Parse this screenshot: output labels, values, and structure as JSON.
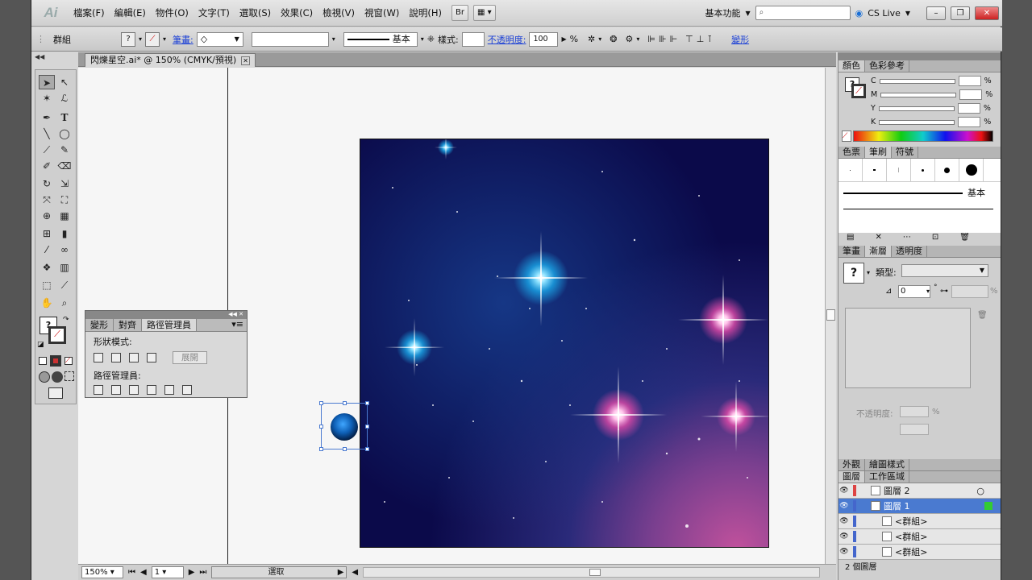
{
  "app": {
    "logo": "Ai",
    "menus": [
      "檔案(F)",
      "編輯(E)",
      "物件(O)",
      "文字(T)",
      "選取(S)",
      "效果(C)",
      "檢視(V)",
      "視窗(W)",
      "說明(H)"
    ],
    "bridge_label": "Br",
    "workspace": "基本功能",
    "cs_live": "CS Live",
    "search_placeholder": ""
  },
  "controlbar": {
    "selection_type": "群組",
    "stroke_label": "筆畫:",
    "stroke_style": "基本",
    "style_label": "樣式:",
    "opacity_label": "不透明度:",
    "opacity_value": "100",
    "pct": "%",
    "transform_label": "變形"
  },
  "document": {
    "tab_title": "閃爍星空.ai* @ 150% (CMYK/預視)"
  },
  "pathfinder_panel": {
    "tabs": [
      "變形",
      "對齊",
      "路徑管理員"
    ],
    "shape_modes_label": "形狀模式:",
    "expand_button": "展開",
    "pathfinders_label": "路徑管理員:"
  },
  "statusbar": {
    "zoom": "150%",
    "page": "1",
    "status": "選取"
  },
  "color_panel": {
    "tabs": [
      "顏色",
      "色彩參考"
    ],
    "channels": [
      "C",
      "M",
      "Y",
      "K"
    ],
    "pct": "%"
  },
  "swatch_panel": {
    "tabs": [
      "色票",
      "筆刷",
      "符號"
    ],
    "brush_label": "基本"
  },
  "gradient_panel": {
    "tabs": [
      "筆畫",
      "漸層",
      "透明度"
    ],
    "type_label": "類型:",
    "angle_value": "0",
    "opacity_label": "不透明度:",
    "pct": "%"
  },
  "layers_panel": {
    "tabs": [
      "外觀",
      "繪圖樣式"
    ],
    "tab2": [
      "圖層",
      "工作區域"
    ],
    "layers": [
      "圖層 2",
      "圖層 1",
      "<群組>",
      "<群組>",
      "<群組>"
    ],
    "footer": "2 個圖層"
  }
}
